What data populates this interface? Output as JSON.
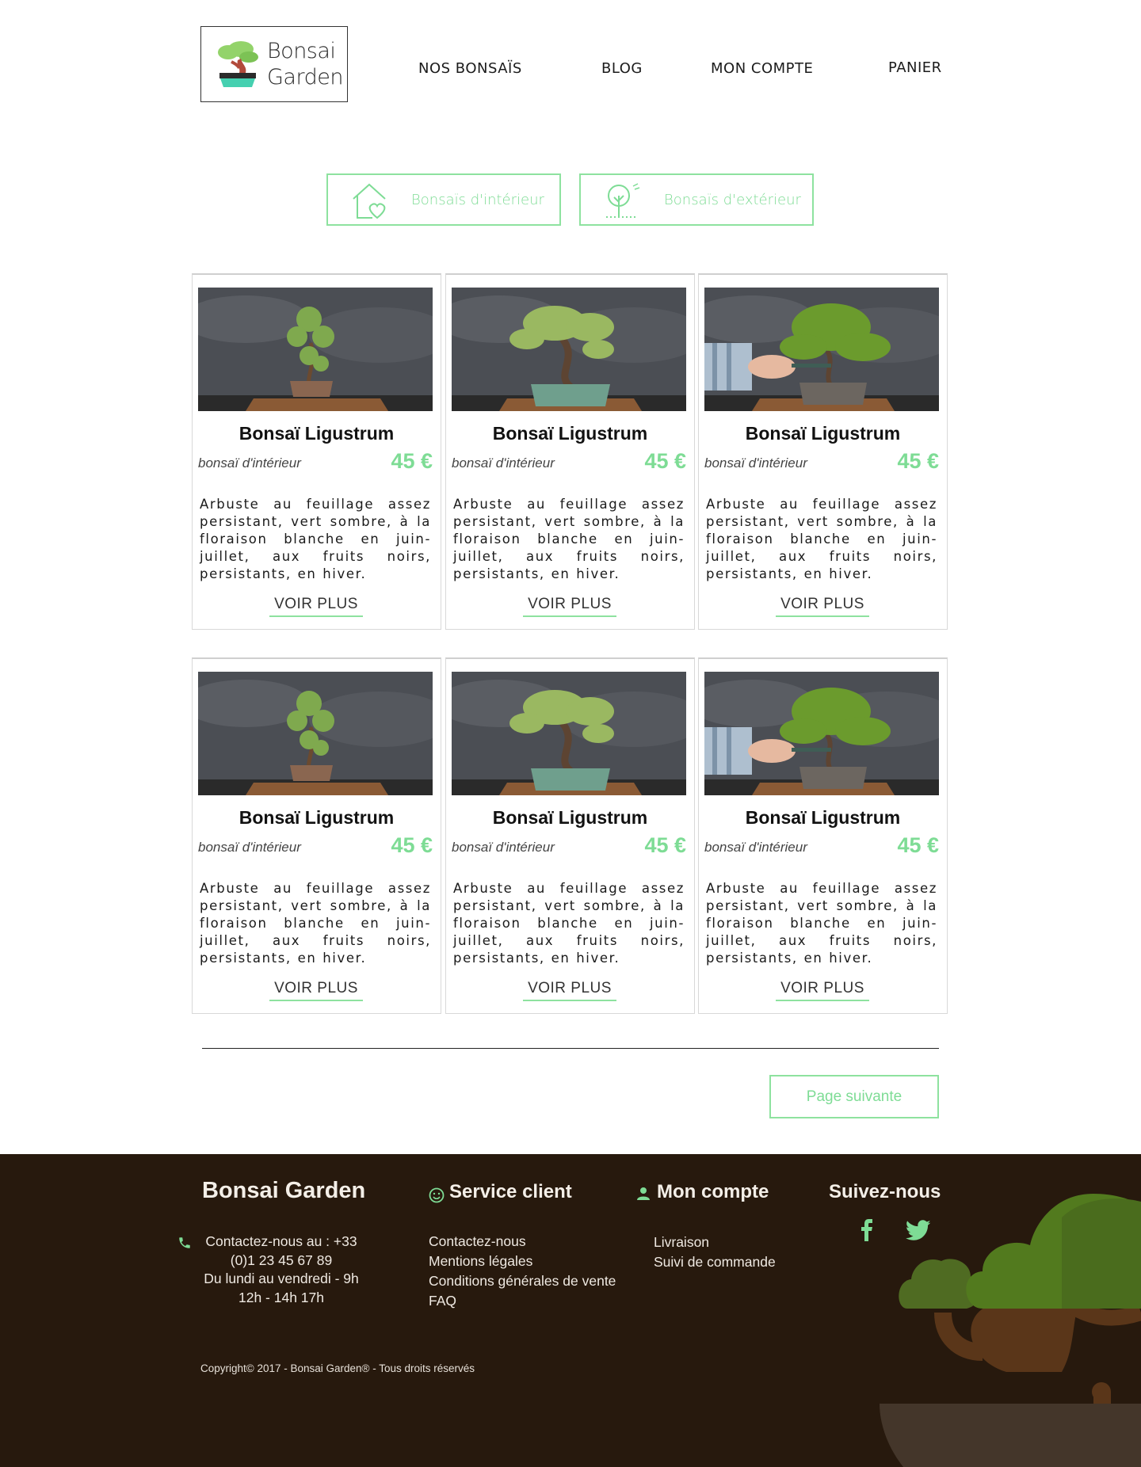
{
  "header": {
    "logo_line1": "Bonsai",
    "logo_line2": "Garden",
    "nav": [
      {
        "label": "NOS BONSAÏS"
      },
      {
        "label": "BLOG"
      },
      {
        "label": "MON COMPTE"
      },
      {
        "label": "PANIER"
      }
    ]
  },
  "categories": [
    {
      "label": "Bonsaïs d'intérieur",
      "icon": "house-heart-icon"
    },
    {
      "label": "Bonsaïs d'extérieur",
      "icon": "tree-icon"
    }
  ],
  "products": [
    {
      "title": "Bonsaï Ligustrum",
      "category": "bonsaï d'intérieur",
      "price": "45 €",
      "description": "Arbuste au feuillage assez persistant, vert sombre, à la floraison blanche en juin-juillet, aux fruits noirs, persistants, en hiver.",
      "more": "VOIR PLUS"
    },
    {
      "title": "Bonsaï Ligustrum",
      "category": "bonsaï d'intérieur",
      "price": "45 €",
      "description": "Arbuste au feuillage assez persistant, vert sombre, à la floraison blanche en juin-juillet, aux fruits noirs, persistants, en hiver.",
      "more": "VOIR PLUS"
    },
    {
      "title": "Bonsaï Ligustrum",
      "category": "bonsaï d'intérieur",
      "price": "45 €",
      "description": "Arbuste au feuillage assez persistant, vert sombre, à la floraison blanche en juin-juillet, aux fruits noirs, persistants, en hiver.",
      "more": "VOIR PLUS"
    },
    {
      "title": "Bonsaï Ligustrum",
      "category": "bonsaï d'intérieur",
      "price": "45 €",
      "description": "Arbuste au feuillage assez persistant, vert sombre, à la floraison blanche en juin-juillet, aux fruits noirs, persistants, en hiver.",
      "more": "VOIR PLUS"
    },
    {
      "title": "Bonsaï Ligustrum",
      "category": "bonsaï d'intérieur",
      "price": "45 €",
      "description": "Arbuste au feuillage assez persistant, vert sombre, à la floraison blanche en juin-juillet, aux fruits noirs, persistants, en hiver.",
      "more": "VOIR PLUS"
    },
    {
      "title": "Bonsaï Ligustrum",
      "category": "bonsaï d'intérieur",
      "price": "45 €",
      "description": "Arbuste au feuillage assez persistant, vert sombre, à la floraison blanche en juin-juillet, aux fruits noirs, persistants, en hiver.",
      "more": "VOIR PLUS"
    }
  ],
  "pagination": {
    "next_label": "Page suivante"
  },
  "footer": {
    "brand": "Bonsai Garden",
    "contact_line1": "Contactez-nous au : +33",
    "contact_line2": "(0)1 23 45 67 89",
    "contact_line3": "Du lundi au vendredi - 9h",
    "contact_line4": "12h - 14h 17h",
    "service": {
      "title": "Service client",
      "links": [
        "Contactez-nous",
        "Mentions légales",
        "Conditions générales de vente",
        "FAQ"
      ]
    },
    "account": {
      "title": "Mon compte",
      "links": [
        "Livraison",
        "Suivi de commande"
      ]
    },
    "follow": {
      "title": "Suivez-nous"
    },
    "copyright": "Copyright© 2017 - Bonsai Garden® - Tous droits réservés"
  },
  "colors": {
    "accent": "#7edc95",
    "footer_bg": "#27190d"
  }
}
